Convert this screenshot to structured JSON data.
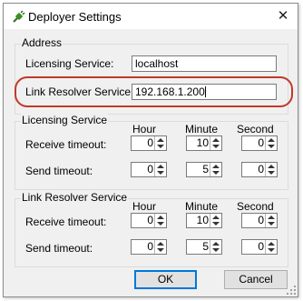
{
  "window": {
    "title": "Deployer Settings",
    "close_glyph": "✕",
    "icon": "app-plug-icon",
    "close_icon": "close-icon"
  },
  "address": {
    "title": "Address",
    "licensing_label": "Licensing Service:",
    "licensing_value": "localhost",
    "resolver_label": "Link Resolver Service:",
    "resolver_value": "192.168.1.200",
    "highlight_color": "#c0392b"
  },
  "licensing": {
    "title": "Licensing Service",
    "headers": {
      "hour": "Hour",
      "minute": "Minute",
      "second": "Second"
    },
    "receive": {
      "label": "Receive timeout:",
      "hour": "0",
      "minute": "10",
      "second": "0"
    },
    "send": {
      "label": "Send timeout:",
      "hour": "0",
      "minute": "5",
      "second": "0"
    }
  },
  "resolver": {
    "title": "Link Resolver Service",
    "headers": {
      "hour": "Hour",
      "minute": "Minute",
      "second": "Second"
    },
    "receive": {
      "label": "Receive timeout:",
      "hour": "0",
      "minute": "10",
      "second": "0"
    },
    "send": {
      "label": "Send timeout:",
      "hour": "0",
      "minute": "5",
      "second": "0"
    }
  },
  "buttons": {
    "ok": "OK",
    "cancel": "Cancel",
    "accent": "#0078d7"
  }
}
